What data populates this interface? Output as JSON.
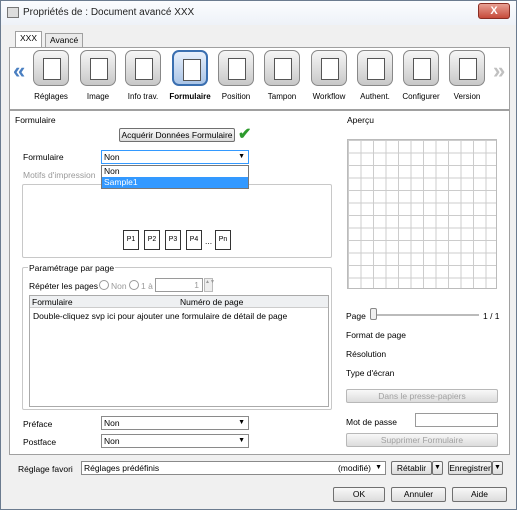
{
  "window": {
    "title": "Propriétés de : Document avancé XXX",
    "close": "X"
  },
  "tabs": [
    {
      "label": "XXX"
    },
    {
      "label": "Avancé"
    }
  ],
  "toolbar": {
    "prev": "«",
    "next": "»",
    "items": [
      {
        "label": "Réglages",
        "icon": "settings-icon"
      },
      {
        "label": "Image",
        "icon": "image-icon"
      },
      {
        "label": "Info trav.",
        "icon": "job-info-icon"
      },
      {
        "label": "Formulaire",
        "icon": "form-icon"
      },
      {
        "label": "Position",
        "icon": "position-icon"
      },
      {
        "label": "Tampon",
        "icon": "stamp-icon"
      },
      {
        "label": "Workflow",
        "icon": "workflow-icon"
      },
      {
        "label": "Authent.",
        "icon": "authentication-icon"
      },
      {
        "label": "Configurer",
        "icon": "configure-icon"
      },
      {
        "label": "Version",
        "icon": "version-icon"
      }
    ]
  },
  "form": {
    "section": "Formulaire",
    "acquire_button": "Acquérir Données Formulaire",
    "form_label": "Formulaire",
    "form_value": "Non",
    "dropdown_options": [
      "Non",
      "Sample1"
    ],
    "print_patterns_label": "Motifs d'impression",
    "pages": [
      "P1",
      "P2",
      "P3",
      "P4",
      "...",
      "Pn"
    ],
    "per_page_group": "Paramétrage par page",
    "repeat_label": "Répéter les pages",
    "radio_no": "Non",
    "radio_range": "1 à",
    "range_value": "1",
    "col_form": "Formulaire",
    "col_page_number": "Numéro de page",
    "hint": "Double-cliquez svp ici pour ajouter une formulaire de détail de page",
    "preface_label": "Préface",
    "preface_value": "Non",
    "postface_label": "Postface",
    "postface_value": "Non"
  },
  "preview": {
    "section": "Aperçu",
    "page_label": "Page",
    "page_count": "1 / 1",
    "page_format": "Format de page",
    "resolution": "Résolution",
    "screen_type": "Type d'écran",
    "clipboard_button": "Dans le presse-papiers",
    "password_label": "Mot de passe",
    "delete_button": "Supprimer Formulaire"
  },
  "favorites": {
    "label": "Réglage favori",
    "value": "Réglages prédéfinis",
    "modified": "(modifié)",
    "restore": "Rétablir",
    "save": "Enregistrer"
  },
  "actions": {
    "ok": "OK",
    "cancel": "Annuler",
    "help": "Aide"
  },
  "colors": {
    "accent": "#3399ff",
    "checkmark": "#2e9b2e"
  }
}
